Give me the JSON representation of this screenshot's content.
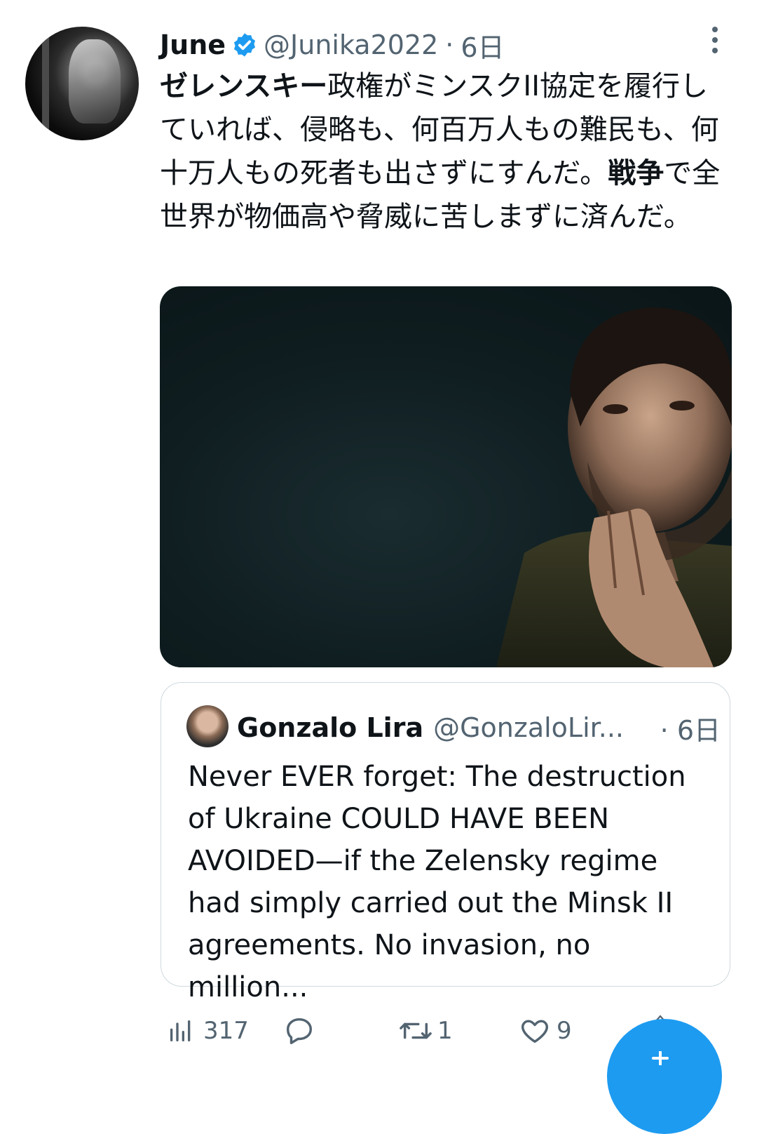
{
  "tweet": {
    "author_name": "June",
    "handle": "@Junika2022",
    "separator": "·",
    "time": "6日",
    "text_segments": [
      {
        "text": "ゼレンスキー",
        "bold": true
      },
      {
        "text": "政権がミンスクII協定を履行していれば、侵略も、何百万人もの難民も、何十万人もの死者も出さずにすんだ。",
        "bold": false
      },
      {
        "text": "戦争",
        "bold": true
      },
      {
        "text": "で全世界が物価高や脅威に苦しまずに済んだ。",
        "bold": false
      }
    ]
  },
  "quoted_tweet": {
    "author_name": "Gonzalo Lira",
    "handle": "@GonzaloLir...",
    "time": "· 6日",
    "text": "Never EVER forget: The destruction of Ukraine COULD HAVE BEEN AVOIDED—if the Zelensky regime had simply carried out the Minsk II agreements. No invasion, no million..."
  },
  "actions": {
    "views": "317",
    "replies": "",
    "retweets": "1",
    "likes": "9"
  },
  "colors": {
    "accent": "#1d9bf0",
    "secondary_text": "#536471",
    "border": "#cfd9de"
  },
  "icons": [
    "verified-badge-icon",
    "more-options-icon",
    "views-icon",
    "reply-icon",
    "retweet-icon",
    "like-icon",
    "share-icon",
    "compose-icon"
  ]
}
